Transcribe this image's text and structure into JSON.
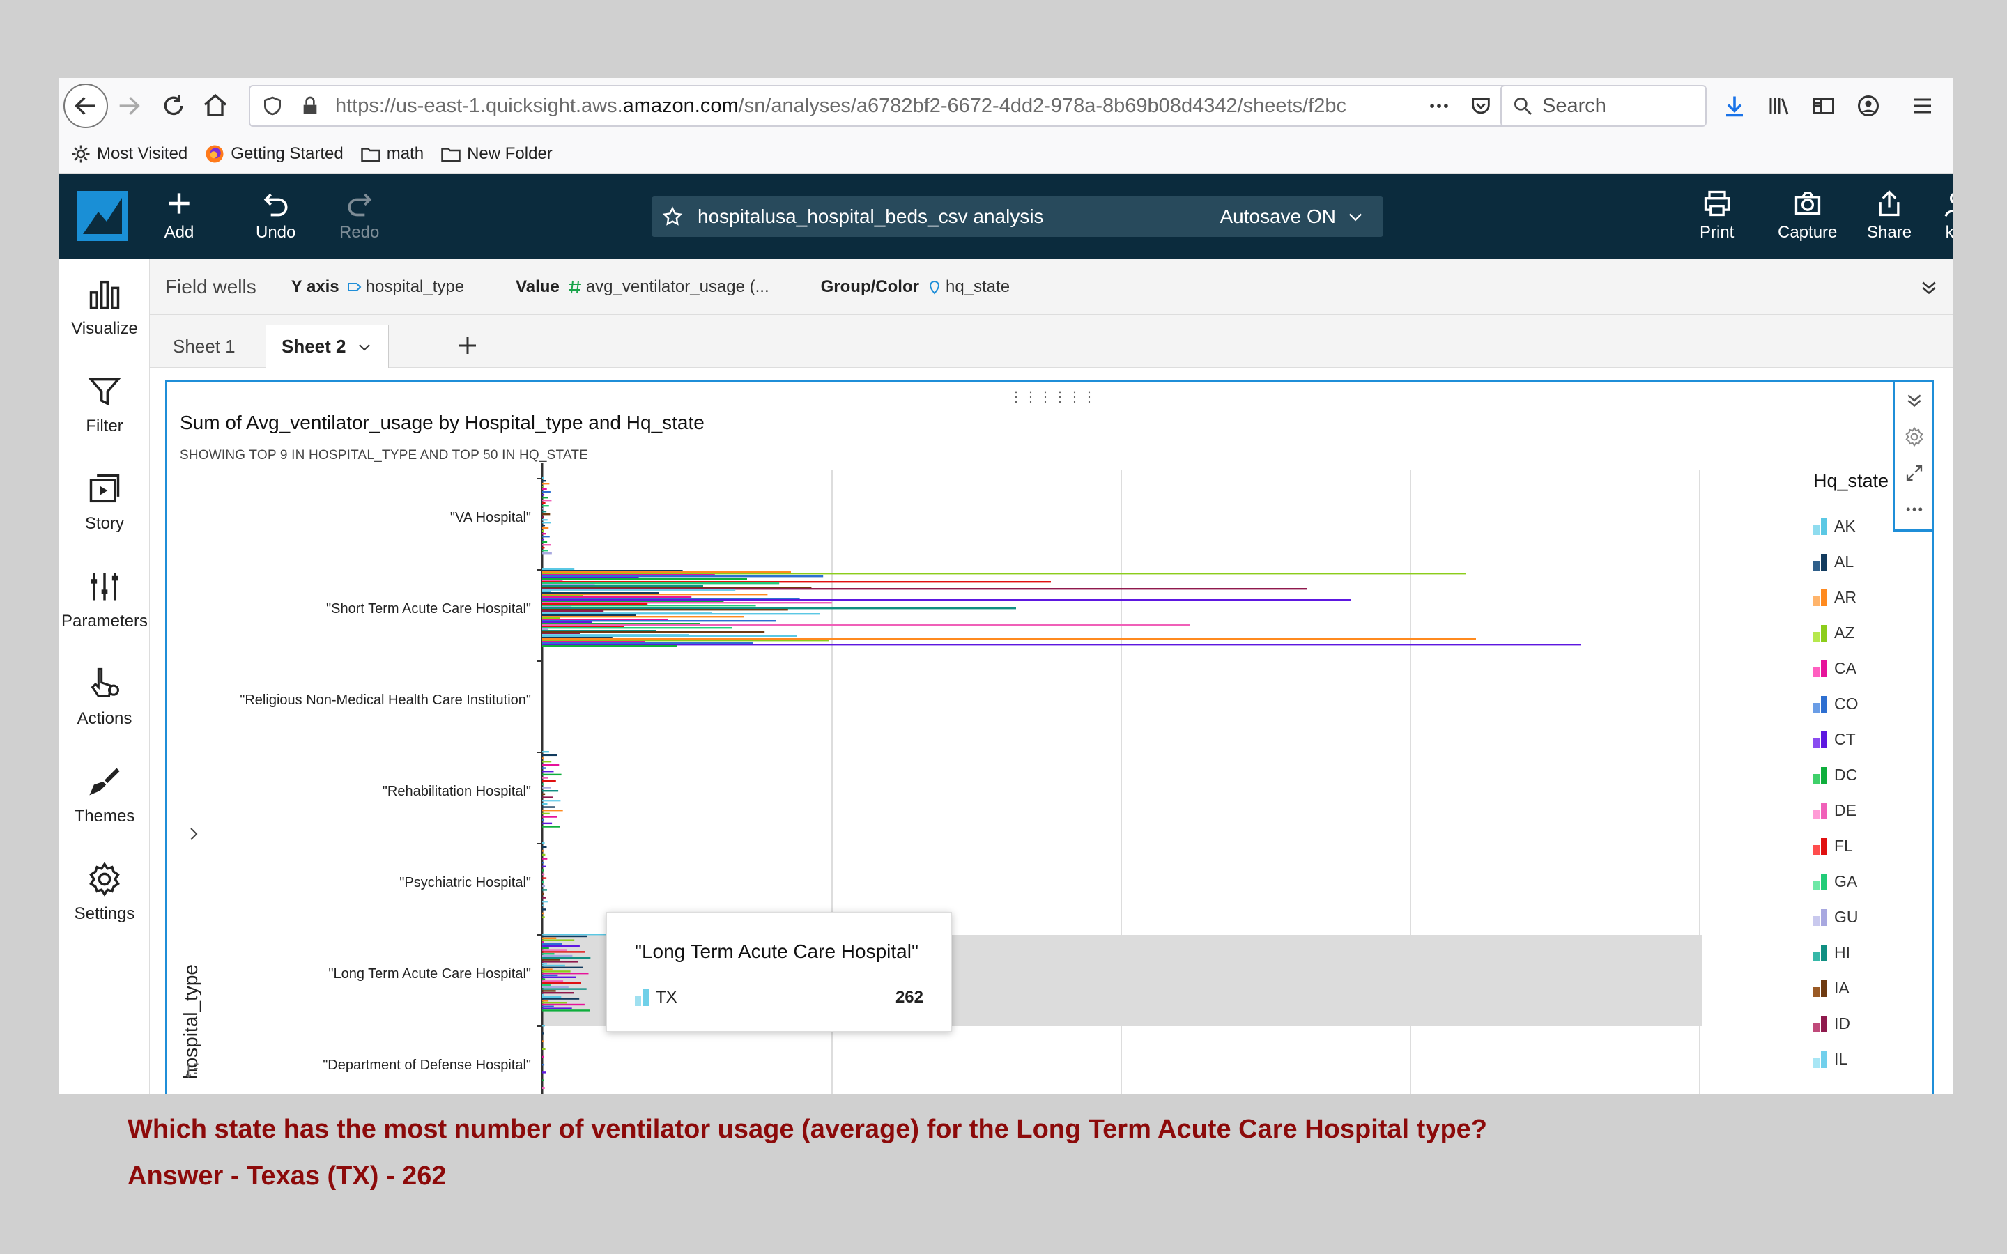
{
  "browser": {
    "url_prefix": "https://us-east-1.quicksight.aws.",
    "url_domain": "amazon.com",
    "url_rest": "/sn/analyses/a6782bf2-6672-4dd2-978a-8b69b08d4342/sheets/f2bc",
    "search_placeholder": "Search"
  },
  "bookmarks": [
    "Most Visited",
    "Getting Started",
    "math",
    "New Folder"
  ],
  "app": {
    "add": "Add",
    "undo": "Undo",
    "redo": "Redo",
    "analysis_title": "hospitalusa_hospital_beds_csv analysis",
    "autosave": "Autosave ON",
    "print": "Print",
    "capture": "Capture",
    "share": "Share",
    "user": "kla"
  },
  "left_panel": [
    "Visualize",
    "Filter",
    "Story",
    "Parameters",
    "Actions",
    "Themes",
    "Settings"
  ],
  "field_wells": {
    "label": "Field wells",
    "y_axis_key": "Y axis",
    "y_axis_val": "hospital_type",
    "value_key": "Value",
    "value_val": "avg_ventilator_usage (...",
    "group_key": "Group/Color",
    "group_val": "hq_state"
  },
  "tabs": [
    "Sheet 1",
    "Sheet 2"
  ],
  "visual": {
    "title": "Sum of Avg_ventilator_usage by Hospital_type and Hq_state",
    "subtitle": "SHOWING TOP 9 IN HOSPITAL_TYPE AND TOP 50 IN HQ_STATE",
    "y_title": "hospital_type",
    "legend_title": "Hq_state",
    "tooltip": {
      "category": "\"Long Term Acute Care Hospital\"",
      "state": "TX",
      "value": "262",
      "color": "#6fd0e8"
    }
  },
  "chart_data": {
    "type": "bar",
    "orientation": "horizontal",
    "categories": [
      "\"VA Hospital\"",
      "\"Short Term Acute Care Hospital\"",
      "\"Religious Non-Medical Health Care Institution\"",
      "\"Rehabilitation Hospital\"",
      "\"Psychiatric Hospital\"",
      "\"Long Term Acute Care Hospital\"",
      "\"Department of Defense Hospital\""
    ],
    "highlighted_category": "\"Long Term Acute Care Hospital\"",
    "legend": [
      {
        "name": "AK",
        "c1": "#8fdcef",
        "c2": "#5bc8e4"
      },
      {
        "name": "AL",
        "c1": "#2f5f8a",
        "c2": "#123b5e"
      },
      {
        "name": "AR",
        "c1": "#ffb46b",
        "c2": "#ff8a1f"
      },
      {
        "name": "AZ",
        "c1": "#b6e84d",
        "c2": "#8ccd1b"
      },
      {
        "name": "CA",
        "c1": "#ff5fc0",
        "c2": "#e6139a"
      },
      {
        "name": "CO",
        "c1": "#6a9de6",
        "c2": "#2e6fd1"
      },
      {
        "name": "CT",
        "c1": "#8a4cf0",
        "c2": "#5d17e0"
      },
      {
        "name": "DC",
        "c1": "#3fd06a",
        "c2": "#0fae3c"
      },
      {
        "name": "DE",
        "c1": "#ff9bd6",
        "c2": "#f060b8"
      },
      {
        "name": "FL",
        "c1": "#ff4d4d",
        "c2": "#e01010"
      },
      {
        "name": "GA",
        "c1": "#6ee8a6",
        "c2": "#22cc78"
      },
      {
        "name": "GU",
        "c1": "#c9c9ee",
        "c2": "#a8a8e0"
      },
      {
        "name": "HI",
        "c1": "#36b8a8",
        "c2": "#108f82"
      },
      {
        "name": "IA",
        "c1": "#9a5a25",
        "c2": "#6e3a10"
      },
      {
        "name": "ID",
        "c1": "#c04a7a",
        "c2": "#8f1a4d"
      },
      {
        "name": "IL",
        "c1": "#a8e6f5",
        "c2": "#72d0ec"
      }
    ]
  },
  "question": "Which state has the most number of ventilator usage (average)  for the Long Term Acute Care Hospital type?",
  "answer": "Answer - Texas (TX) - 262"
}
